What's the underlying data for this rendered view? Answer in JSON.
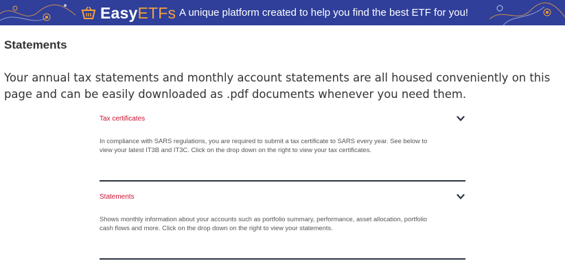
{
  "banner": {
    "brand_main": "Easy",
    "brand_accent": "ETFs",
    "tagline": "A unique platform created to help you find the best ETF for you!",
    "colors": {
      "background": "#2f3f9a",
      "accent": "#f4a23a"
    },
    "icon": "basket-icon"
  },
  "page": {
    "title": "Statements",
    "intro": "Your annual tax statements and monthly account statements are all housed conveniently on this page and can be easily downloaded as .pdf documents whenever you need them."
  },
  "sections": [
    {
      "label": "Tax certificates",
      "description": "In compliance with SARS regulations, you are required to submit a tax certificate to SARS every year. See below to view your latest IT3B and IT3C. Click on the drop down on the right to view your tax certificates.",
      "icon": "chevron-down-icon"
    },
    {
      "label": "Statements",
      "description": "Shows monthly information about your accounts such as portfolio summary, performance, asset allocation, portfolio cash flows and more. Click on the drop down on the right to view your statements.",
      "icon": "chevron-down-icon"
    }
  ],
  "colors": {
    "section_label": "#c8102e",
    "divider": "#2c3440"
  }
}
